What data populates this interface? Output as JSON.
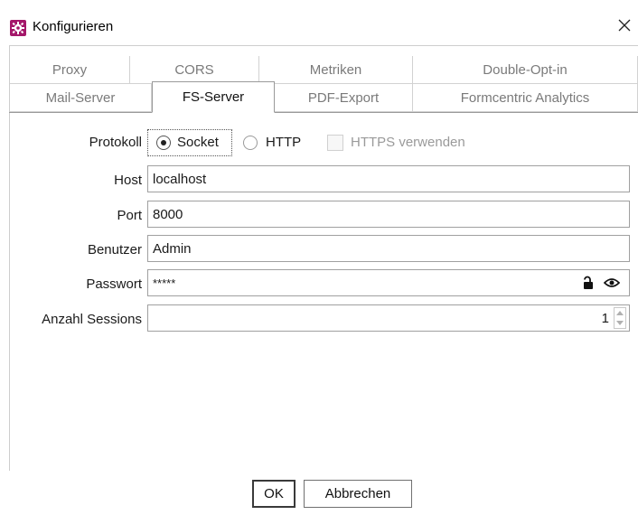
{
  "window": {
    "title": "Konfigurieren",
    "close_glyph": "✕"
  },
  "tabs": {
    "row1": [
      {
        "label": "Proxy"
      },
      {
        "label": "CORS"
      },
      {
        "label": "Metriken"
      },
      {
        "label": "Double-Opt-in"
      }
    ],
    "row2": [
      {
        "label": "Mail-Server"
      },
      {
        "label": "FS-Server",
        "active": true
      },
      {
        "label": "PDF-Export"
      },
      {
        "label": "Formcentric Analytics"
      }
    ]
  },
  "form": {
    "protokoll": {
      "label": "Protokoll",
      "socket_label": "Socket",
      "http_label": "HTTP",
      "https_label": "HTTPS verwenden",
      "selected": "Socket",
      "https_checked": false
    },
    "host": {
      "label": "Host",
      "value": "localhost"
    },
    "port": {
      "label": "Port",
      "value": "8000"
    },
    "benutzer": {
      "label": "Benutzer",
      "value": "Admin"
    },
    "passwort": {
      "label": "Passwort",
      "value": "*****"
    },
    "sessions": {
      "label": "Anzahl Sessions",
      "value": "1"
    }
  },
  "buttons": {
    "ok": "OK",
    "cancel": "Abbrechen"
  },
  "icons": {
    "app": "gear-icon",
    "lock": "unlock-icon",
    "eye": "eye-icon",
    "close": "close-icon"
  },
  "colors": {
    "app_icon": "#a4186a"
  }
}
